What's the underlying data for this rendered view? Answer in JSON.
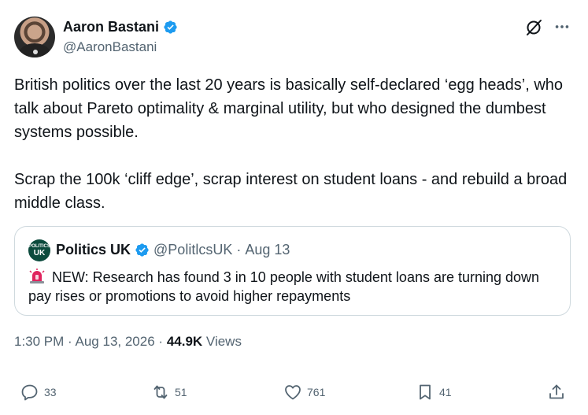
{
  "author": {
    "name": "Aaron Bastani",
    "handle": "@AaronBastani"
  },
  "tweet": {
    "paragraph1": "British politics over the last 20 years is basically self-declared ‘egg heads’, who talk about Pareto optimality & marginal utility, but who designed the dumbest systems possible.",
    "paragraph2": "Scrap the 100k ‘cliff edge’, scrap interest on student loans - and rebuild a broad middle class."
  },
  "quote": {
    "avatar_small": "POLITICS",
    "avatar_big": "UK",
    "name": "Politics UK",
    "handle": "@PolitlcsUK",
    "separator": "·",
    "date": "Aug 13",
    "body": "NEW: Research has found 3 in 10 people with student loans are turning down pay rises or promotions to avoid higher repayments"
  },
  "meta": {
    "time": "1:30 PM",
    "sep": "·",
    "date": "Aug 13, 2026",
    "sep2": "·",
    "views_count": "44.9K",
    "views_label": "Views"
  },
  "actions": {
    "replies": "33",
    "reposts": "51",
    "likes": "761",
    "bookmarks": "41"
  },
  "colors": {
    "verified_blue": "#1d9bf0",
    "secondary_text": "#536471",
    "border": "#cfd9de"
  },
  "icons": [
    "verified-icon",
    "grok-icon",
    "more-icon",
    "siren-icon",
    "reply-icon",
    "repost-icon",
    "like-icon",
    "bookmark-icon",
    "share-icon"
  ]
}
